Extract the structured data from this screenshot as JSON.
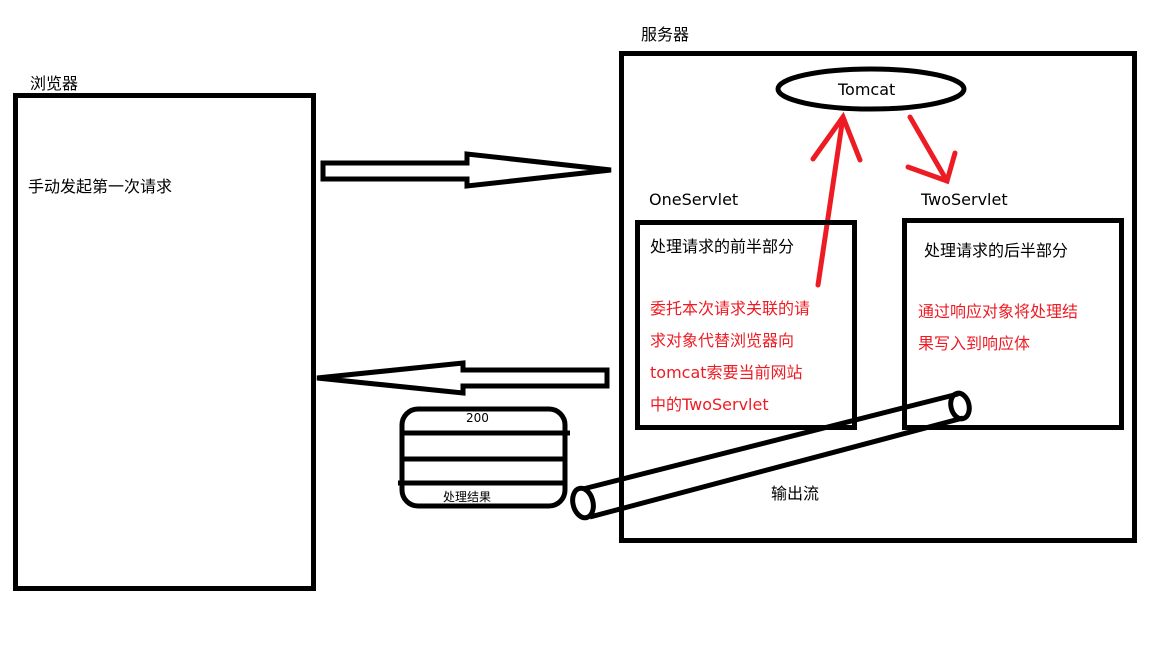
{
  "browser": {
    "title": "浏览器",
    "content": "手动发起第一次请求"
  },
  "server": {
    "title": "服务器",
    "tomcat": "Tomcat",
    "one_servlet": {
      "name": "OneServlet",
      "heading": "处理请求的前半部分",
      "note_lines": [
        "委托本次请求关联的请",
        "求对象代替浏览器向",
        "tomcat索要当前网站",
        "中的TwoServlet"
      ]
    },
    "two_servlet": {
      "name": "TwoServlet",
      "heading": "处理请求的后半部分",
      "note_lines": [
        "通过响应对象将处理结",
        "果写入到响应体"
      ]
    }
  },
  "response_packet": {
    "status": "200",
    "body": "处理结果"
  },
  "output_stream": {
    "label": "输出流"
  },
  "colors": {
    "stroke": "#000000",
    "accent": "#ed1c24"
  }
}
